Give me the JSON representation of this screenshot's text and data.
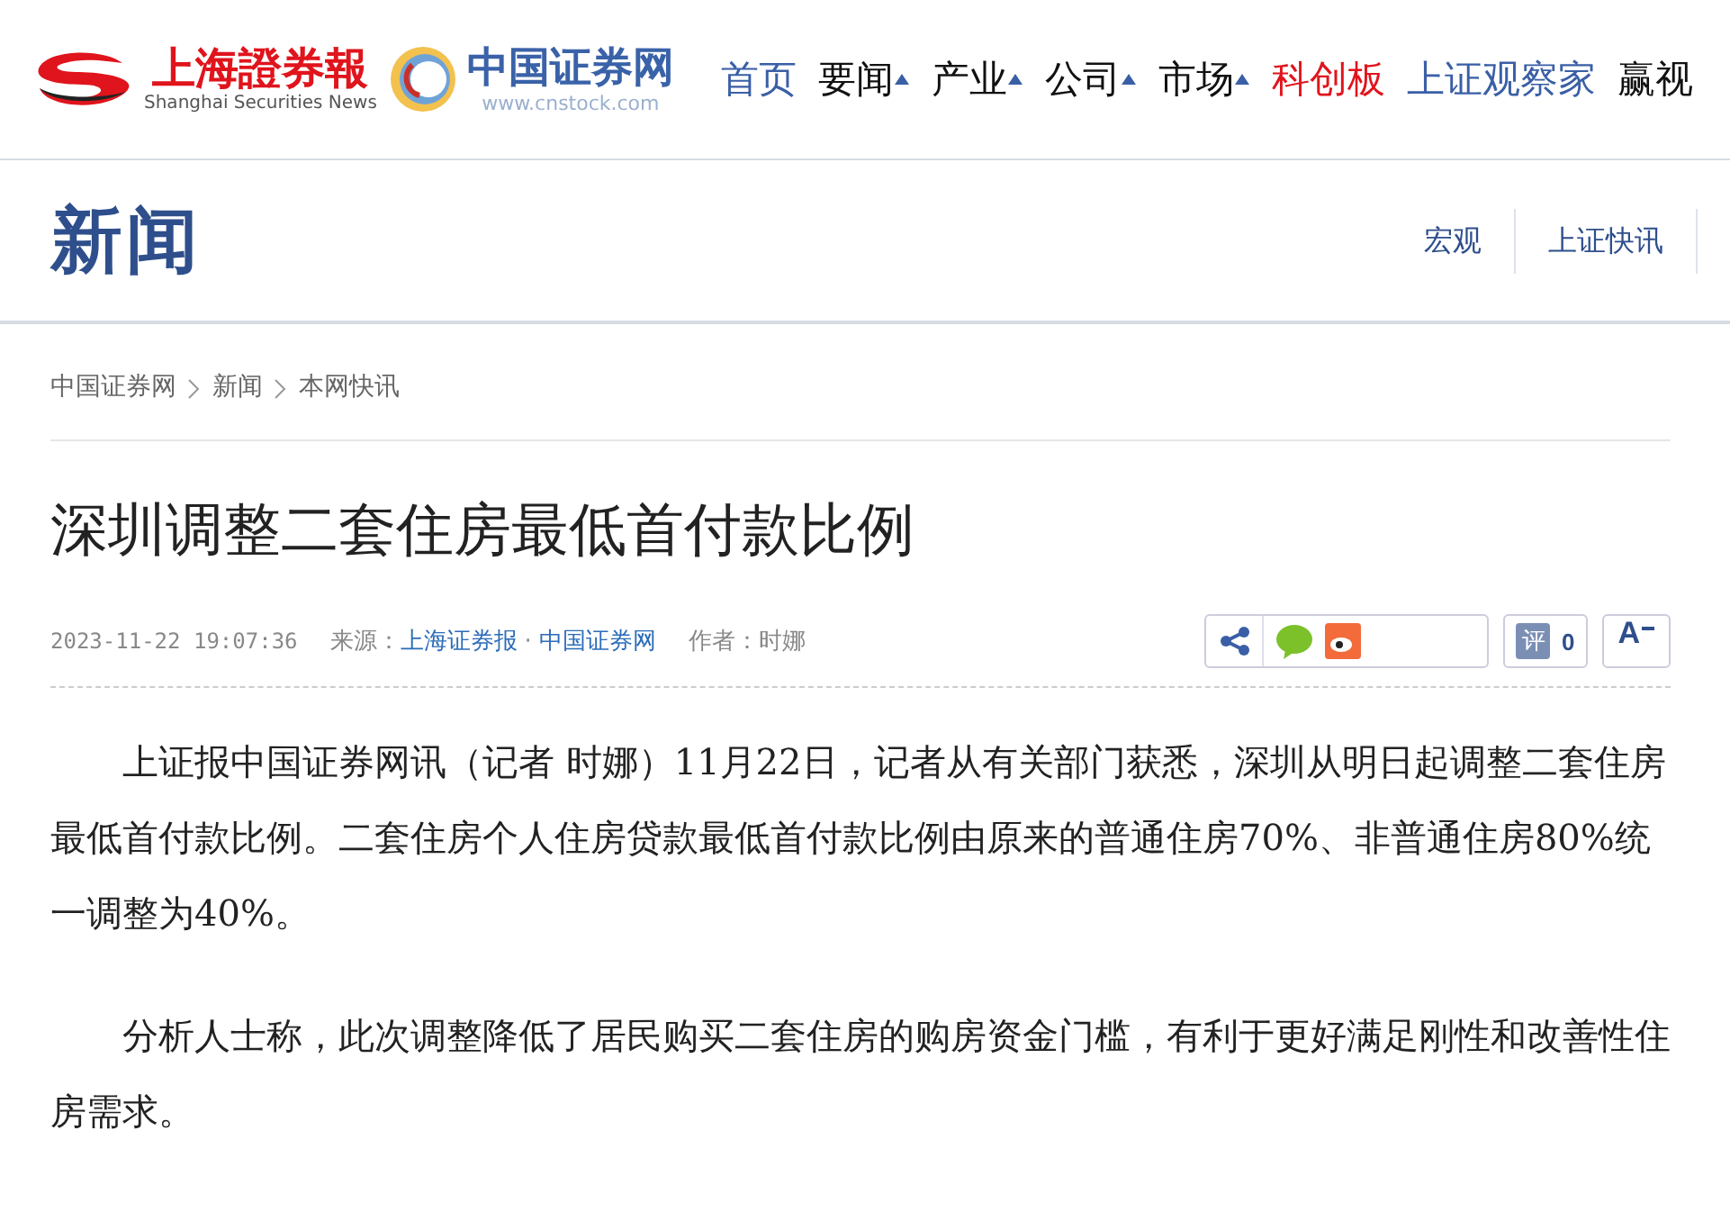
{
  "logos": [
    {
      "kind": "shzq",
      "name": "上海證券報",
      "subtitle": "Shanghai Securities News"
    },
    {
      "kind": "cnstock",
      "name": "中国证券网",
      "subtitle": "www.cnstock.com"
    }
  ],
  "nav": [
    {
      "label": "首页",
      "color": "#3a5fa6",
      "dropdown": false
    },
    {
      "label": "要闻",
      "color": "#111111",
      "dropdown": true
    },
    {
      "label": "产业",
      "color": "#111111",
      "dropdown": true
    },
    {
      "label": "公司",
      "color": "#111111",
      "dropdown": true
    },
    {
      "label": "市场",
      "color": "#111111",
      "dropdown": true
    },
    {
      "label": "科创板",
      "color": "#e0141c",
      "dropdown": false
    },
    {
      "label": "上证观察家",
      "color": "#3a5fa6",
      "dropdown": false
    },
    {
      "label": "赢视",
      "color": "#111111",
      "dropdown": false
    }
  ],
  "section": {
    "title": "新闻",
    "links": [
      "宏观",
      "上证快讯"
    ]
  },
  "breadcrumb": [
    "中国证券网",
    "新闻",
    "本网快讯"
  ],
  "article": {
    "title": "深圳调整二套住房最低首付款比例",
    "time": "2023-11-22 19:07:36",
    "source_label": "来源：",
    "sources": [
      "上海证券报",
      "中国证券网"
    ],
    "source_separator": "·",
    "author": "作者：时娜",
    "comment_icon": "评",
    "comment_count": "0",
    "font_button": "A",
    "paragraphs": [
      "上证报中国证券网讯（记者 时娜）11月22日，记者从有关部门获悉，深圳从明日起调整二套住房最低首付款比例。二套住房个人住房贷款最低首付款比例由原来的普通住房70%、非普通住房80%统一调整为40%。",
      "分析人士称，此次调整降低了居民购买二套住房的购房资金门槛，有利于更好满足刚性和改善性住房需求。"
    ]
  }
}
